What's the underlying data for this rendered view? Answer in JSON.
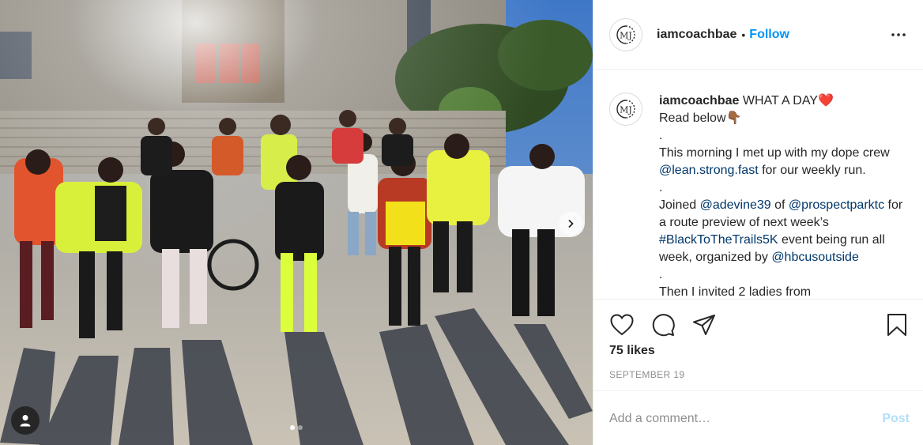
{
  "post": {
    "image_alt": "Group of runners posing in front of a building on a sunny morning",
    "carousel_count": 2,
    "carousel_active": 0
  },
  "header": {
    "username": "iamcoachbae",
    "separator": "•",
    "follow_label": "Follow",
    "avatar_monogram": "MJ"
  },
  "caption": {
    "username": "iamcoachbae",
    "line1_text": " WHAT A DAY",
    "line1_emoji": "❤️",
    "line2_text": "Read below",
    "line2_emoji": "👇🏾",
    "spacer1": ".",
    "para1_text": "This morning I met up with my dope crew ",
    "para1_mention": "@lean.strong.fast",
    "para1_end": " for our weekly run.",
    "spacer2": ".",
    "para2_start": "Joined ",
    "para2_mention1": "@adevine39",
    "para2_of": " of ",
    "para2_mention2": "@prospectparktc",
    "para2_middle": " for a route preview of next week’s ",
    "para2_hashtag": "#BlackToTheTrails5K",
    "para2_after": " event being run all week, organized by ",
    "para2_mention3": "@hbcusoutside",
    "spacer3": ".",
    "para3_text": "Then I invited 2 ladies from"
  },
  "actions": {
    "like_icon": "heart-icon",
    "comment_icon": "comment-icon",
    "share_icon": "share-icon",
    "save_icon": "bookmark-icon"
  },
  "likes": "75 likes",
  "date": "SEPTEMBER 19",
  "comment": {
    "placeholder": "Add a comment…",
    "post_label": "Post"
  },
  "colors": {
    "link": "#0095f6",
    "mention": "#00376b",
    "post_disabled": "#b2dffc",
    "muted": "#8e8e8e"
  }
}
